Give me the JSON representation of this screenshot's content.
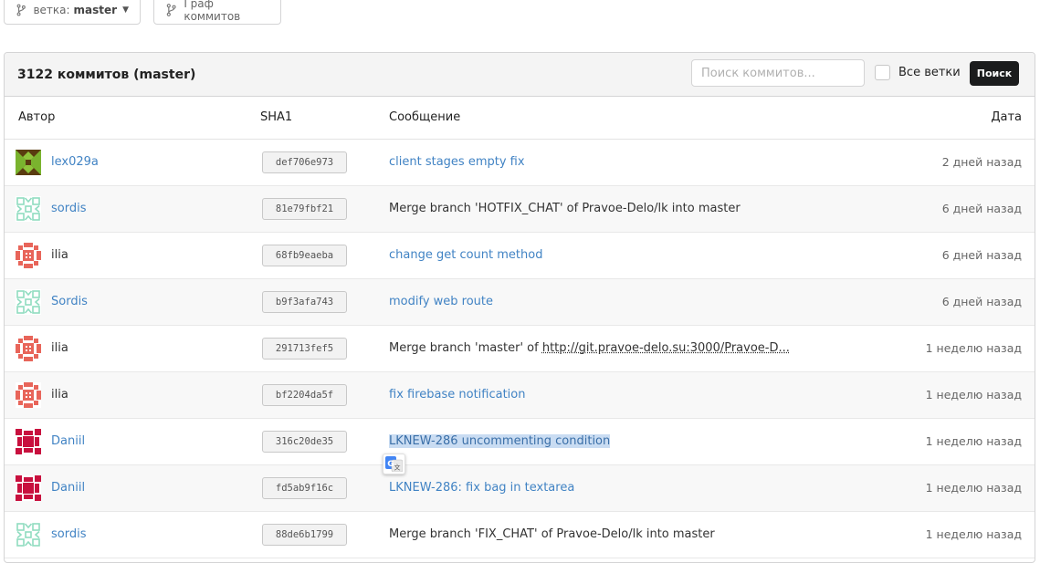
{
  "toolbar": {
    "branch_prefix": "ветка:",
    "branch_name": "master",
    "graph_label": "Граф коммитов"
  },
  "panel": {
    "title": "3122 коммитов (master)",
    "search_placeholder": "Поиск коммитов...",
    "all_branches_label": "Все ветки",
    "search_button": "Поиск"
  },
  "columns": {
    "author": "Автор",
    "sha": "SHA1",
    "message": "Сообщение",
    "date": "Дата"
  },
  "commits": [
    {
      "author": "lex029a",
      "sha": "def706e973",
      "message": "client stages empty fix",
      "date": "2 дней назад"
    },
    {
      "author": "sordis",
      "sha": "81e79fbf21",
      "message": "Merge branch 'HOTFIX_CHAT' of Pravoe-Delo/lk into master",
      "date": "6 дней назад"
    },
    {
      "author": "ilia",
      "sha": "68fb9eaeba",
      "message": "change get count method",
      "date": "6 дней назад"
    },
    {
      "author": "Sordis",
      "sha": "b9f3afa743",
      "message": "modify web route",
      "date": "6 дней назад"
    },
    {
      "author": "ilia",
      "sha": "291713fef5",
      "message": "Merge branch 'master' of ",
      "message_url": "http://git.pravoe-delo.su:3000/Pravoe-D...",
      "date": "1 неделю назад"
    },
    {
      "author": "ilia",
      "sha": "bf2204da5f",
      "message": "fix firebase notification",
      "date": "1 неделю назад"
    },
    {
      "author": "Daniil",
      "sha": "316c20de35",
      "message": "LKNEW-286 uncommenting condition",
      "date": "1 неделю назад"
    },
    {
      "author": "Daniil",
      "sha": "fd5ab9f16c",
      "message": "LKNEW-286: fix bag in textarea",
      "date": "1 неделю назад"
    },
    {
      "author": "sordis",
      "sha": "88de6b1799",
      "message": "Merge branch 'FIX_CHAT' of Pravoe-Delo/lk into master",
      "date": "1 неделю назад"
    }
  ],
  "colors": {
    "link": "#4183c4",
    "search_button_bg": "#1b1c1d",
    "selection": "#c9dcf2"
  },
  "icons": [
    "branch-icon",
    "caret-down-icon",
    "graph-icon",
    "translate-icon"
  ]
}
